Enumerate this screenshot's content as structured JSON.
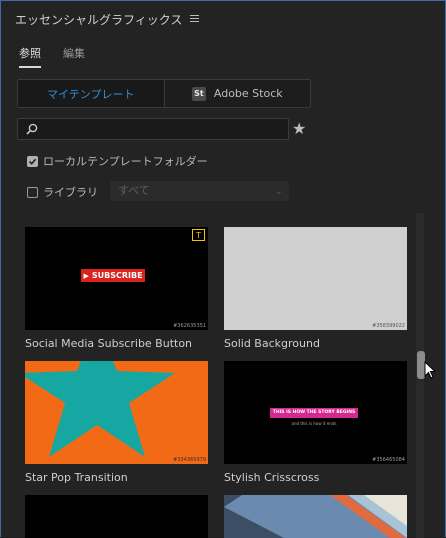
{
  "header": {
    "title": "エッセンシャルグラフィックス",
    "menu_icon": "hamburger-icon"
  },
  "tabs": [
    {
      "label": "参照",
      "active": true
    },
    {
      "label": "編集",
      "active": false
    }
  ],
  "source_toggle": {
    "my_templates": "マイテンプレート",
    "adobe_stock": "Adobe Stock",
    "stock_logo": "St"
  },
  "search": {
    "placeholder": "",
    "value": ""
  },
  "filters": {
    "local_templates": {
      "label": "ローカルテンプレートフォルダー",
      "checked": true
    },
    "libraries": {
      "label": "ライブラリ",
      "checked": false,
      "selected": "すべて"
    }
  },
  "templates": [
    {
      "label": "Social Media Subscribe Button",
      "id": "#362635351",
      "button_text": "SUBSCRIBE"
    },
    {
      "label": "Solid Background",
      "id": "#358399022"
    },
    {
      "label": "Star Pop Transition",
      "id": "#334365979"
    },
    {
      "label": "Stylish Crisscross",
      "id": "#356465084",
      "headline": "THIS IS HOW THE STORY BEGINS",
      "subline": "and this is how it ends"
    },
    {
      "label": ""
    },
    {
      "label": ""
    }
  ],
  "colors": {
    "accent": "#2f8fdc",
    "subscribe_red": "#d8231f",
    "star_orange": "#f26a16",
    "star_teal": "#16a7a3",
    "magenta": "#d42a8f"
  }
}
